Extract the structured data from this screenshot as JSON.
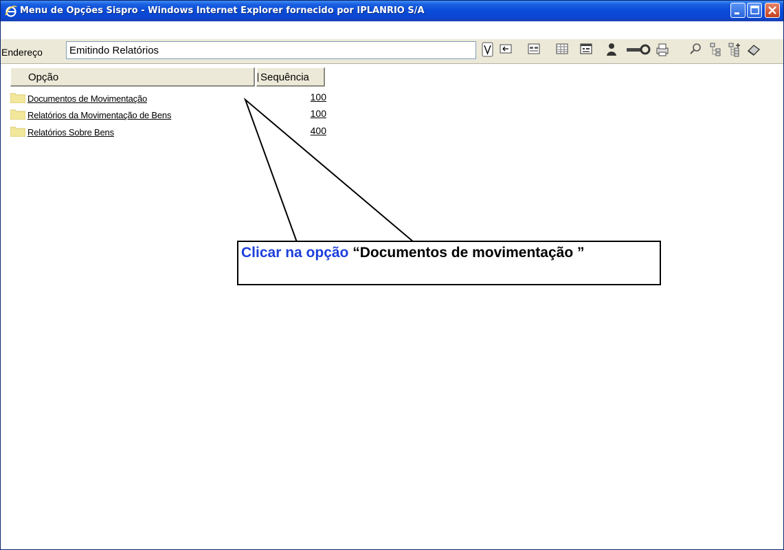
{
  "window": {
    "title": "Menu de Opções Sispro - Windows Internet Explorer fornecido por IPLANRIO S/A",
    "controls": [
      "minimize-icon",
      "maximize-icon",
      "close-icon"
    ]
  },
  "address_bar": {
    "label": "Endereço",
    "value": "Emitindo Relatórios"
  },
  "toolbar": {
    "icons": [
      {
        "name": "validate-icon",
        "glyph": "V"
      },
      {
        "name": "back-folder-icon",
        "glyph": "⮌"
      },
      {
        "name": "form-view-icon",
        "glyph": "▤"
      },
      {
        "name": "table-view-icon",
        "glyph": "▦"
      },
      {
        "name": "grid-view-icon",
        "glyph": "▩"
      },
      {
        "name": "user-icon",
        "glyph": "♟"
      },
      {
        "name": "key-icon",
        "glyph": "⚿"
      },
      {
        "name": "print-icon",
        "glyph": "⎙"
      },
      {
        "name": "search-icon",
        "glyph": "⌕"
      },
      {
        "name": "tree-collapse-icon",
        "glyph": "⊟"
      },
      {
        "name": "tree-expand-icon",
        "glyph": "⊞"
      },
      {
        "name": "eraser-icon",
        "glyph": "◈"
      }
    ]
  },
  "table": {
    "columns": [
      "Opção",
      "Sequência"
    ],
    "rows": [
      {
        "option": "Documentos de Movimentação",
        "sequence": "100"
      },
      {
        "option": "Relatórios da Movimentação de Bens",
        "sequence": "100"
      },
      {
        "option": "Relatórios Sobre Bens",
        "sequence": "400"
      }
    ]
  },
  "callout": {
    "prefix": "Clicar na opção",
    "text": "“Documentos de movimentação ”",
    "accent_color": "#1d3fdc"
  },
  "colors": {
    "titlebar": "#0a4bd8",
    "toolbar_bg": "#ece9d8",
    "folder": "#f2e79a"
  }
}
